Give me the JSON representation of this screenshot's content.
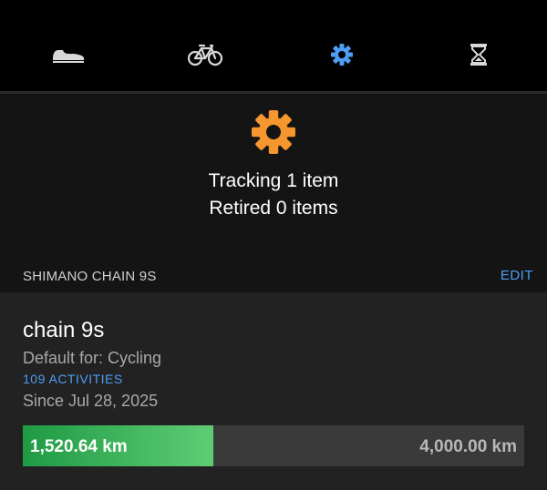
{
  "tabs": [
    {
      "name": "shoe",
      "icon": "shoe-icon",
      "selected": false
    },
    {
      "name": "bike",
      "icon": "bicycle-icon",
      "selected": false
    },
    {
      "name": "other",
      "icon": "gear-icon",
      "selected": true
    },
    {
      "name": "history",
      "icon": "hourglass-icon",
      "selected": false
    }
  ],
  "summary": {
    "icon": "gear-icon",
    "tracking_text": "Tracking 1 item",
    "retired_text": "Retired 0 items"
  },
  "section": {
    "title": "SHIMANO CHAIN 9S",
    "edit_label": "EDIT"
  },
  "item": {
    "name": "chain 9s",
    "default_for": "Default for: Cycling",
    "activities": "109 ACTIVITIES",
    "since": "Since Jul 28, 2025",
    "distance_current": "1,520.64 km",
    "distance_goal": "4,000.00 km",
    "progress_fraction": 0.38
  },
  "colors": {
    "accent": "#4d9ef5",
    "gear_orange": "#f5962e",
    "progress_green_start": "#1f9a45",
    "progress_green_end": "#5fcd74",
    "tab_icon_inactive": "#d8d8d8"
  }
}
